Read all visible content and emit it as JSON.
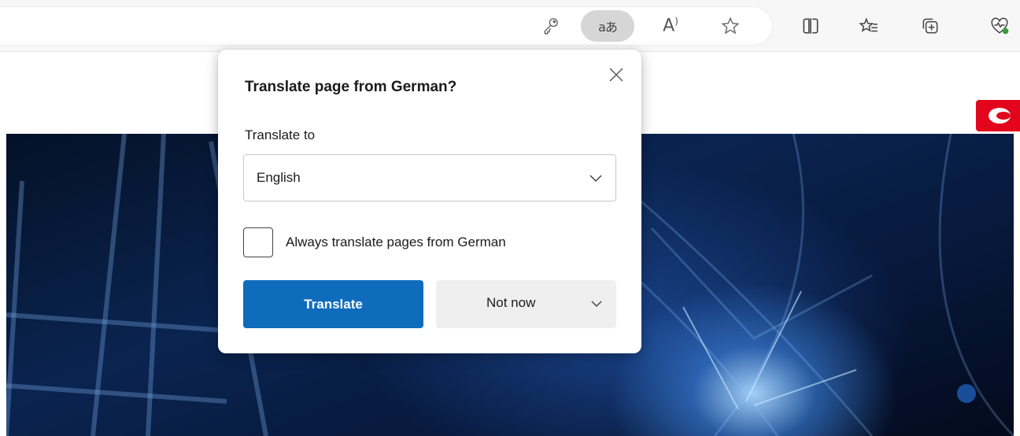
{
  "toolbar": {
    "icons": [
      "key-icon",
      "translate-icon",
      "read-aloud-icon",
      "favorite-star-icon",
      "split-screen-icon",
      "favorites-list-icon",
      "collections-icon",
      "browser-essentials-icon"
    ],
    "translate_glyph": "aあ",
    "read_aloud_glyph": "A"
  },
  "popup": {
    "title": "Translate page from German?",
    "translate_to_label": "Translate to",
    "selected_language": "English",
    "always_translate_label": "Always translate pages from German",
    "always_translate_checked": false,
    "translate_button": "Translate",
    "not_now_button": "Not now"
  },
  "colors": {
    "primary_button": "#0f6cbd",
    "brand_logo": "#e3051b",
    "hero_dark": "#041127"
  }
}
